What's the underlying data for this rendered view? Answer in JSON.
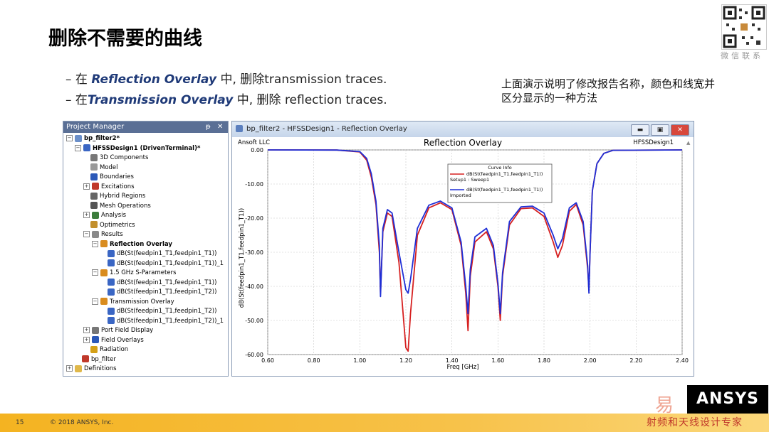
{
  "slide": {
    "title": "删除不需要的曲线",
    "bullet1_pre": "– 在 ",
    "bullet1_em": "Reflection Overlay",
    "bullet1_post": " 中, 删除transmission traces.",
    "bullet2_pre": "– 在",
    "bullet2_em": "Transmission Overlay",
    "bullet2_post": " 中, 删除 reflection traces.",
    "note": "上面演示说明了修改报告名称，颜色和线宽并区分显示的一种方法",
    "qr_caption": "微信联系",
    "page_number": "15",
    "copyright": "© 2018 ANSYS, Inc.",
    "logo": "ANSYS",
    "watermark_top": "易",
    "watermark_bottom": "射频和天线设计专家"
  },
  "project_manager": {
    "title": "Project Manager",
    "pin": "ᵽ",
    "close": "✕",
    "items": [
      {
        "label": "bp_filter2*",
        "level": 0,
        "bold": true,
        "exp": "−",
        "icon": "#6b8fc9"
      },
      {
        "label": "HFSSDesign1 (DrivenTerminal)*",
        "level": 1,
        "bold": true,
        "exp": "−",
        "icon": "#3a66c4"
      },
      {
        "label": "3D Components",
        "level": 2,
        "bold": false,
        "exp": "",
        "icon": "#777"
      },
      {
        "label": "Model",
        "level": 2,
        "bold": false,
        "exp": "",
        "icon": "#999"
      },
      {
        "label": "Boundaries",
        "level": 2,
        "bold": false,
        "exp": "",
        "icon": "#2b58b8"
      },
      {
        "label": "Excitations",
        "level": 2,
        "bold": false,
        "exp": "+",
        "icon": "#c0392b"
      },
      {
        "label": "Hybrid Regions",
        "level": 2,
        "bold": false,
        "exp": "",
        "icon": "#666"
      },
      {
        "label": "Mesh Operations",
        "level": 2,
        "bold": false,
        "exp": "",
        "icon": "#555"
      },
      {
        "label": "Analysis",
        "level": 2,
        "bold": false,
        "exp": "+",
        "icon": "#3c7d3c"
      },
      {
        "label": "Optimetrics",
        "level": 2,
        "bold": false,
        "exp": "",
        "icon": "#c28f2c"
      },
      {
        "label": "Results",
        "level": 2,
        "bold": false,
        "exp": "−",
        "icon": "#8a8a8a"
      },
      {
        "label": "Reflection Overlay",
        "level": 3,
        "bold": true,
        "exp": "−",
        "icon": "#d98c1f"
      },
      {
        "label": "dB(St(feedpin1_T1,feedpin1_T1))",
        "level": 4,
        "bold": false,
        "exp": "",
        "icon": "#3a66c4"
      },
      {
        "label": "dB(St(feedpin1_T1,feedpin1_T1))_1",
        "level": 4,
        "bold": false,
        "exp": "",
        "icon": "#3a66c4"
      },
      {
        "label": "1.5 GHz S-Parameters",
        "level": 3,
        "bold": false,
        "exp": "−",
        "icon": "#d98c1f"
      },
      {
        "label": "dB(St(feedpin1_T1,feedpin1_T1))",
        "level": 4,
        "bold": false,
        "exp": "",
        "icon": "#3a66c4"
      },
      {
        "label": "dB(St(feedpin1_T1,feedpin1_T2))",
        "level": 4,
        "bold": false,
        "exp": "",
        "icon": "#3a66c4"
      },
      {
        "label": "Transmission Overlay",
        "level": 3,
        "bold": false,
        "exp": "−",
        "icon": "#d98c1f"
      },
      {
        "label": "dB(St(feedpin1_T1,feedpin1_T2))",
        "level": 4,
        "bold": false,
        "exp": "",
        "icon": "#3a66c4"
      },
      {
        "label": "dB(St(feedpin1_T1,feedpin1_T2))_1",
        "level": 4,
        "bold": false,
        "exp": "",
        "icon": "#3a66c4"
      },
      {
        "label": "Port Field Display",
        "level": 2,
        "bold": false,
        "exp": "+",
        "icon": "#777"
      },
      {
        "label": "Field Overlays",
        "level": 2,
        "bold": false,
        "exp": "+",
        "icon": "#2b58b8"
      },
      {
        "label": "Radiation",
        "level": 2,
        "bold": false,
        "exp": "",
        "icon": "#d4a017"
      },
      {
        "label": "bp_filter",
        "level": 1,
        "bold": false,
        "exp": "",
        "icon": "#c0392b"
      },
      {
        "label": "Definitions",
        "level": 0,
        "bold": false,
        "exp": "+",
        "icon": "#e0b84a"
      }
    ]
  },
  "report_window": {
    "title": "bp_filter2 - HFSSDesign1 - Reflection Overlay",
    "btn_min": "▬",
    "btn_max": "▣",
    "btn_close": "✕"
  },
  "chart_data": {
    "type": "line",
    "title": "Reflection Overlay",
    "left_label": "Ansoft LLC",
    "right_label": "HFSSDesign1",
    "xlabel": "Freq [GHz]",
    "ylabel": "dB(St(feedpin1_T1,feedpin1_T1))",
    "xlim": [
      0.6,
      2.4
    ],
    "ylim": [
      -60,
      0
    ],
    "xticks": [
      "0.60",
      "0.80",
      "1.00",
      "1.20",
      "1.40",
      "1.60",
      "1.80",
      "2.00",
      "2.20",
      "2.40"
    ],
    "yticks": [
      "0.00",
      "-10.00",
      "-20.00",
      "-30.00",
      "-40.00",
      "-50.00",
      "-60.00"
    ],
    "legend_title": "Curve Info",
    "legend_placement": "top-center",
    "colors": {
      "red": "#d62020",
      "blue": "#1f2fd6"
    },
    "series": [
      {
        "name": "dB(St(feedpin1_T1,feedpin1_T1))",
        "subname": "Setup1 : Sweep1",
        "color": "#d62020",
        "x": [
          0.6,
          0.9,
          1.0,
          1.03,
          1.05,
          1.07,
          1.085,
          1.09,
          1.1,
          1.12,
          1.14,
          1.17,
          1.2,
          1.21,
          1.22,
          1.25,
          1.3,
          1.35,
          1.4,
          1.44,
          1.46,
          1.47,
          1.48,
          1.5,
          1.55,
          1.58,
          1.6,
          1.61,
          1.62,
          1.65,
          1.7,
          1.75,
          1.8,
          1.84,
          1.86,
          1.88,
          1.91,
          1.94,
          1.97,
          1.99,
          1.995,
          2.0,
          2.01,
          2.03,
          2.06,
          2.1,
          2.4
        ],
        "y": [
          0.0,
          -0.05,
          -0.6,
          -3.0,
          -8.0,
          -16.0,
          -30.0,
          -42.0,
          -24.0,
          -18.5,
          -19.5,
          -33.0,
          -58.0,
          -59.0,
          -48.0,
          -25.0,
          -17.0,
          -15.5,
          -17.5,
          -28.0,
          -42.0,
          -53.0,
          -37.0,
          -27.0,
          -24.0,
          -29.0,
          -40.0,
          -50.0,
          -37.0,
          -22.0,
          -17.2,
          -17.0,
          -19.5,
          -27.0,
          -31.5,
          -28.0,
          -18.0,
          -16.0,
          -22.0,
          -35.0,
          -41.0,
          -30.0,
          -12.0,
          -4.0,
          -1.0,
          -0.1,
          0.0
        ]
      },
      {
        "name": "dB(St(feedpin1_T1,feedpin1_T1))",
        "subname": "Imported",
        "color": "#1f2fd6",
        "x": [
          0.6,
          0.9,
          1.0,
          1.03,
          1.05,
          1.07,
          1.085,
          1.09,
          1.1,
          1.12,
          1.14,
          1.17,
          1.2,
          1.21,
          1.22,
          1.25,
          1.3,
          1.35,
          1.4,
          1.44,
          1.46,
          1.47,
          1.48,
          1.5,
          1.55,
          1.58,
          1.6,
          1.61,
          1.62,
          1.65,
          1.7,
          1.75,
          1.8,
          1.84,
          1.86,
          1.88,
          1.91,
          1.94,
          1.97,
          1.99,
          1.995,
          2.0,
          2.01,
          2.03,
          2.06,
          2.1,
          2.4
        ],
        "y": [
          0.0,
          -0.05,
          -0.5,
          -2.5,
          -7.0,
          -15.0,
          -28.0,
          -43.0,
          -23.0,
          -17.5,
          -18.5,
          -30.0,
          -41.0,
          -42.0,
          -38.0,
          -23.0,
          -16.2,
          -15.0,
          -17.0,
          -27.0,
          -40.0,
          -48.0,
          -35.0,
          -25.5,
          -23.0,
          -28.0,
          -39.0,
          -48.0,
          -36.0,
          -21.0,
          -16.7,
          -16.5,
          -18.5,
          -25.0,
          -29.0,
          -26.0,
          -17.0,
          -15.5,
          -21.0,
          -34.0,
          -42.0,
          -30.0,
          -12.0,
          -4.0,
          -1.0,
          -0.1,
          0.0
        ]
      }
    ]
  }
}
